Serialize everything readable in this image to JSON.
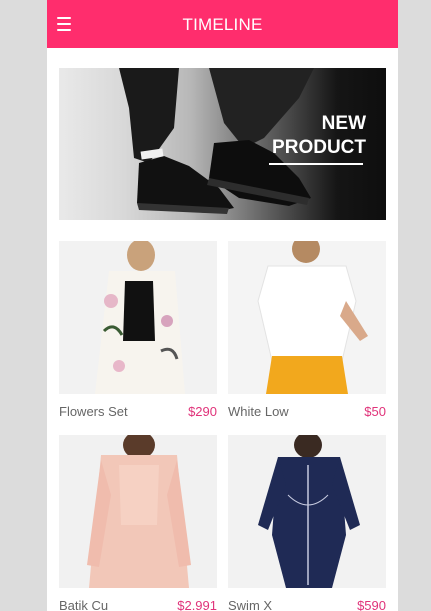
{
  "header": {
    "title": "TIMELINE",
    "menu_icon": "hamburger-menu-icon"
  },
  "banner": {
    "line1": "NEW",
    "line2": "PRODUCT"
  },
  "products": [
    {
      "name": "Flowers Set",
      "price": "$290"
    },
    {
      "name": "White Low",
      "price": "$50"
    },
    {
      "name": "Batik Cu",
      "price": "$2.991"
    },
    {
      "name": "Swim X",
      "price": "$590"
    }
  ],
  "colors": {
    "accent": "#ff2d6d",
    "price": "#e0337a"
  }
}
